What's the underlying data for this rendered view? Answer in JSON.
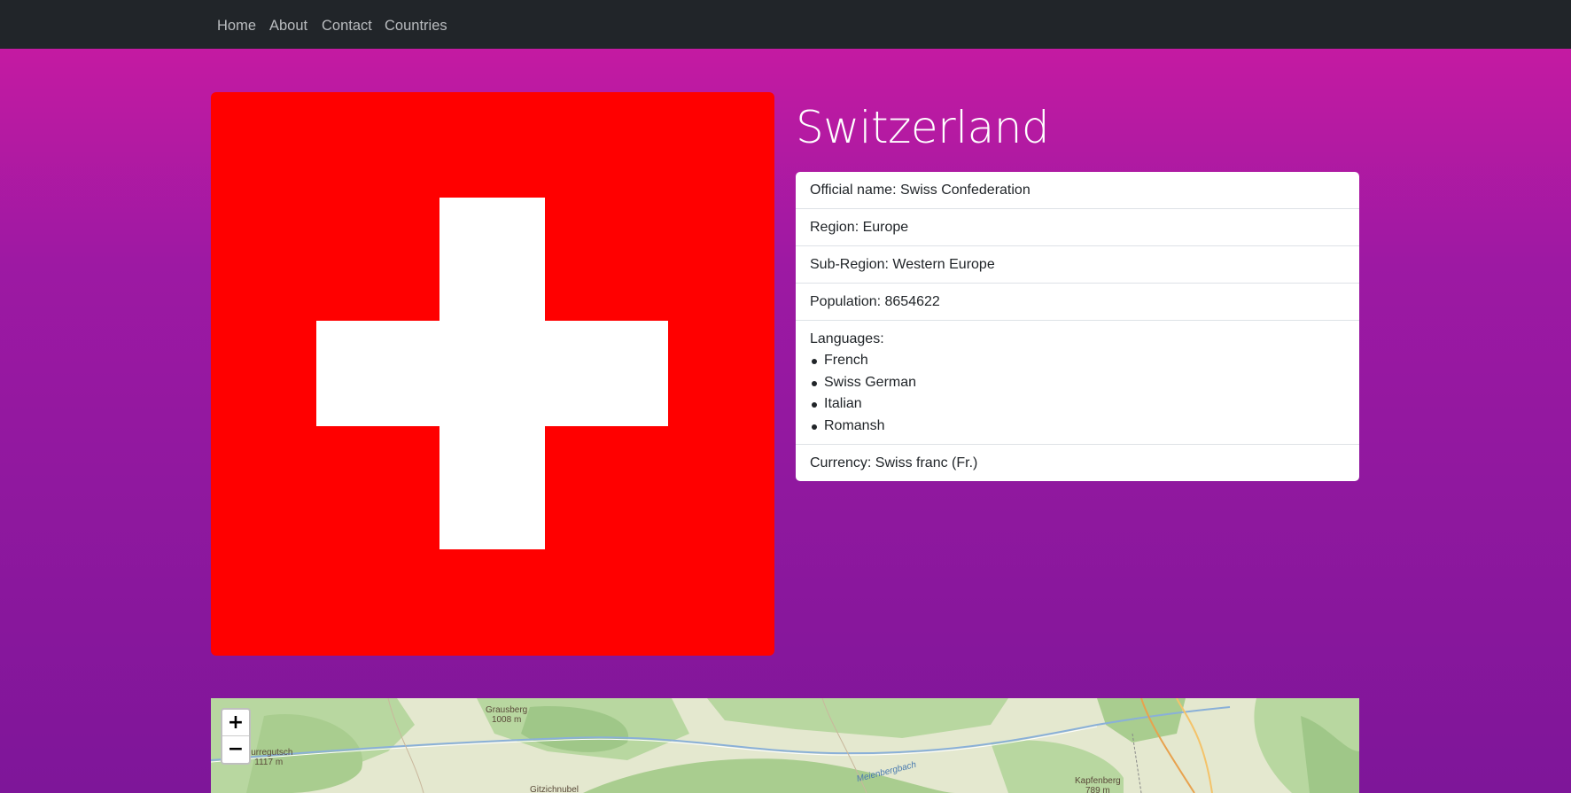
{
  "nav": {
    "items": [
      {
        "label": "Home"
      },
      {
        "label": "About"
      },
      {
        "label": "Contact"
      },
      {
        "label": "Countries"
      }
    ]
  },
  "country": {
    "name": "Switzerland",
    "flag": {
      "colors": {
        "background": "#ff0000",
        "cross": "#ffffff"
      }
    }
  },
  "info": {
    "official_name": "Official name: Swiss Confederation",
    "region": "Region: Europe",
    "subregion": "Sub-Region: Western Europe",
    "population": "Population: 8654622",
    "languages_label": "Languages:",
    "languages": [
      "French",
      "Swiss German",
      "Italian",
      "Romansh"
    ],
    "currency": "Currency: Swiss franc (Fr.)"
  },
  "map": {
    "zoom_in": "+",
    "zoom_out": "−",
    "labels": {
      "grausberg": "Grausberg",
      "grausberg_elev": "1008 m",
      "durregutsch": "Durregutsch",
      "durregutsch_elev": "1117 m",
      "gitzichnubel": "Gitzichnubel",
      "kapfenberg": "Kapfenberg",
      "kapfenberg_elev": "789 m",
      "river": "Meienbergbach"
    }
  }
}
